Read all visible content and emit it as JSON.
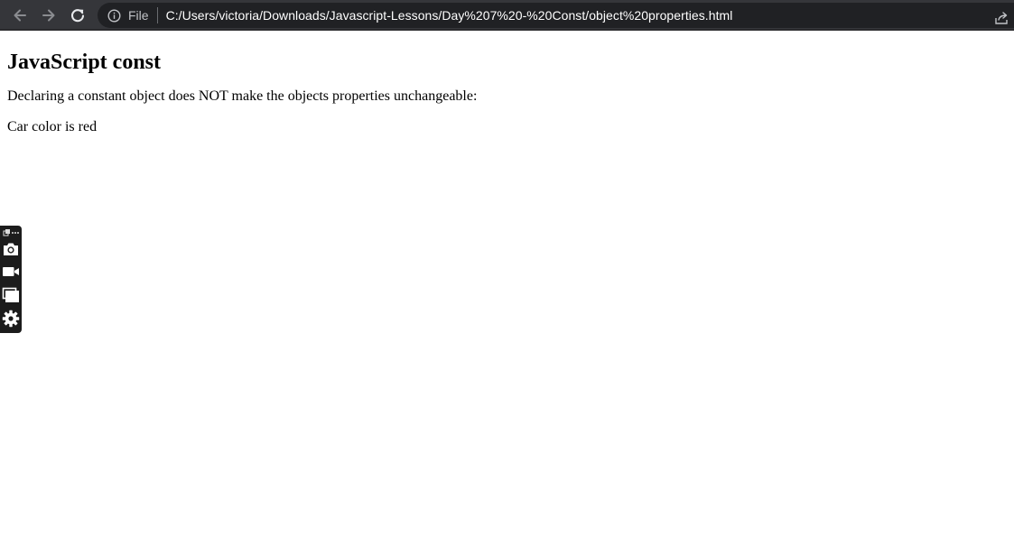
{
  "browser": {
    "file_label": "File",
    "url": "C:/Users/victoria/Downloads/Javascript-Lessons/Day%207%20-%20Const/object%20properties.html",
    "icons": [
      "back-arrow-icon",
      "forward-arrow-icon",
      "reload-icon",
      "info-icon",
      "share-icon"
    ]
  },
  "page": {
    "heading": "JavaScript const",
    "description": "Declaring a constant object does NOT make the objects properties unchangeable:",
    "result": "Car color is red"
  },
  "floating_toolbar": {
    "icons": [
      "extension-menu-icon",
      "camera-icon",
      "video-camera-icon",
      "window-capture-icon",
      "gear-icon"
    ]
  },
  "colors": {
    "toolbar_bg": "#35363a",
    "omnibox_bg": "#202124",
    "url_text": "#ffffff",
    "floating_bar_bg": "#1c1c1c"
  }
}
